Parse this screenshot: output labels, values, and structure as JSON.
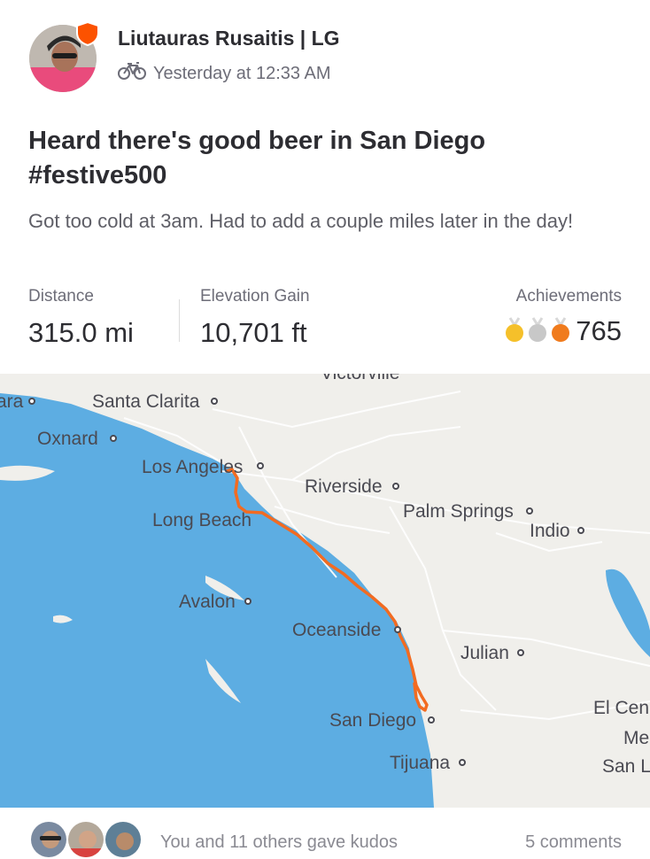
{
  "header": {
    "athlete_name": "Liutauras Rusaitis | LG",
    "timestamp": "Yesterday at 12:33 AM",
    "activity_icon": "bicycle-icon",
    "badge_icon": "shield-badge-icon"
  },
  "activity": {
    "title": "Heard there's good beer in San Diego #festive500",
    "description": "Got too cold at 3am. Had to add a couple miles later in the day!"
  },
  "stats": {
    "distance_label": "Distance",
    "distance_value": "315.0 mi",
    "elevation_label": "Elevation Gain",
    "elevation_value": "10,701 ft",
    "achievements_label": "Achievements",
    "achievements_count": "765",
    "medal_colors": [
      "#f5c02a",
      "#c8c8c8",
      "#f07b1d"
    ]
  },
  "map": {
    "labels": {
      "victorville": "Victorville",
      "ara": "ara",
      "santa_clarita": "Santa Clarita",
      "oxnard": "Oxnard",
      "los_angeles": "Los Angeles",
      "riverside": "Riverside",
      "long_beach": "Long Beach",
      "palm_springs": "Palm Springs",
      "indio": "Indio",
      "avalon": "Avalon",
      "oceanside": "Oceanside",
      "julian": "Julian",
      "san_diego": "San Diego",
      "el_cen": "El Cen",
      "me": "Me",
      "san_l": "San L",
      "tijuana": "Tijuana"
    },
    "route_color": "#f26b21",
    "water_color": "#5dade2",
    "land_color": "#f0efeb"
  },
  "footer": {
    "kudos_text": "You and 11 others gave kudos",
    "comments_text": "5 comments"
  }
}
